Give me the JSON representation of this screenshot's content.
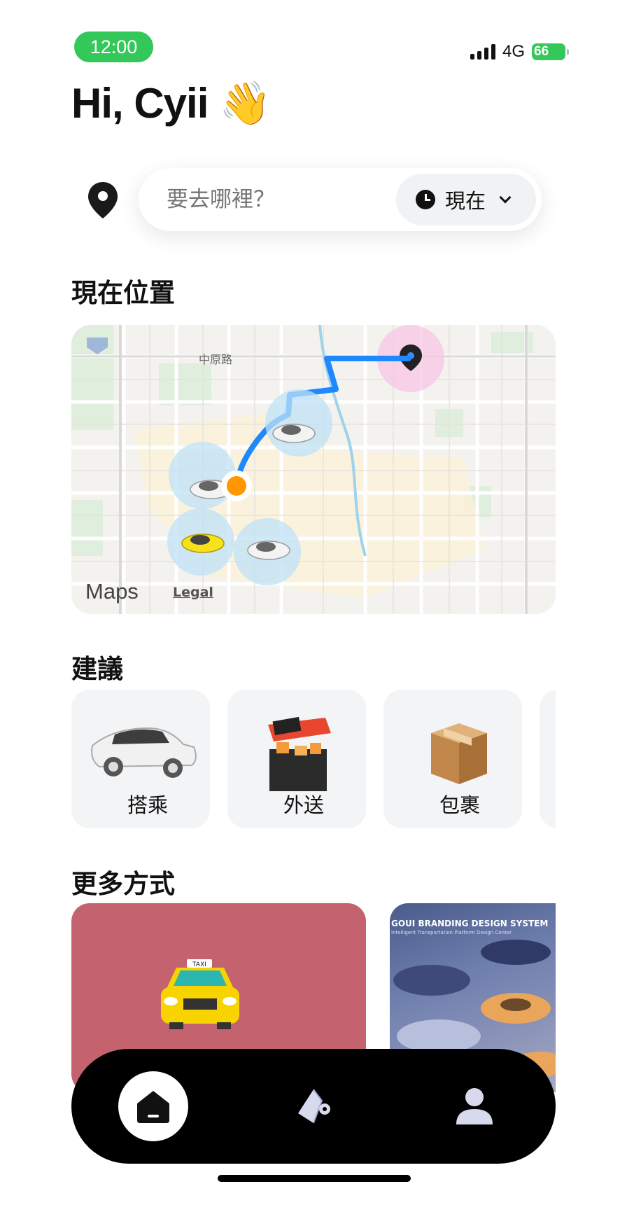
{
  "status_bar": {
    "time": "12:00",
    "network": "4G",
    "battery": "66"
  },
  "greeting": "Hi, Cyii 👋",
  "search": {
    "placeholder": "要去哪裡？",
    "time_option": "現在"
  },
  "location_section": {
    "title": "現在位置",
    "map": {
      "road_label": "中原路",
      "maps_brand": "Maps",
      "legal": "Legal"
    }
  },
  "suggestions": {
    "title": "建議",
    "items": [
      {
        "label": "搭乘",
        "icon": "car-icon"
      },
      {
        "label": "外送",
        "icon": "food-stall-icon"
      },
      {
        "label": "包裹",
        "icon": "package-icon"
      }
    ]
  },
  "more": {
    "title": "更多方式",
    "promos": [
      {
        "icon": "taxi-icon",
        "badge": "TAXI",
        "color": "#c4626d"
      },
      {
        "title": "GOUI BRANDING DESIGN SYSTEM",
        "subtitle": "Intelligent Transportation Platform Design Center"
      }
    ]
  },
  "tabbar": {
    "tabs": [
      "home-icon",
      "route-icon",
      "profile-icon"
    ]
  },
  "colors": {
    "accent_green": "#34c759",
    "route_blue": "#1e88ff",
    "origin_orange": "#ff9800",
    "promo_red": "#c4626d"
  }
}
